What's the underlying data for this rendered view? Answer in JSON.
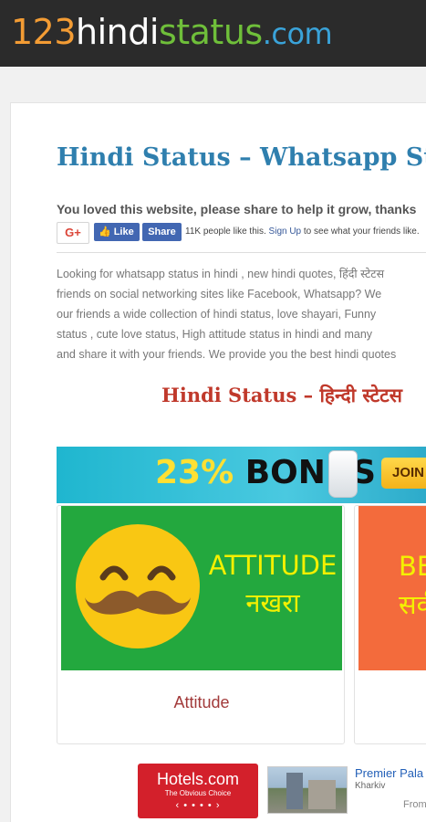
{
  "header": {
    "logo": {
      "num": "123",
      "hindi": "hindi",
      "status": "status",
      "com": ".com"
    }
  },
  "main": {
    "title": "Hindi Status – Whatsapp Status",
    "share_prompt": "You loved this website, please share to help it grow, thanks",
    "social": {
      "gplus_label": "G+",
      "like_label": "Like",
      "share_label": "Share",
      "count_text": "11K people like this.",
      "signup_text": "Sign Up",
      "count_suffix": " to see what your friends like."
    },
    "intro_lines": [
      "Looking for whatsapp status in hindi , new hindi quotes, हिंदी स्टेटस",
      "friends on social networking sites like Facebook, Whatsapp? We",
      "our friends a wide collection of hindi status, love shayari, Funny",
      "status , cute love status, High attitude status in hindi and many",
      "and share it with your friends. We provide you the best hindi quotes"
    ],
    "sub_heading": "Hindi Status – हिन्दी स्टेटस"
  },
  "ad_banner": {
    "percent": "23%",
    "bonus": " BONUS",
    "cta": "JOIN"
  },
  "categories": [
    {
      "image_text_en": "ATTITUDE",
      "image_text_hi": "नखरा",
      "label": "Attitude"
    },
    {
      "image_text_en": "BE",
      "image_text_hi": "सर्व",
      "label": ""
    }
  ],
  "bottom_ads": {
    "hotels_brand": "Hotels.com",
    "hotels_tagline": "The Obvious Choice",
    "hotels_arrows": "‹ • • • • ›",
    "hotel_name": "Premier Pala",
    "hotel_city": "Kharkiv",
    "hotel_from": "From"
  },
  "colors": {
    "header_bg": "#2b2b2b",
    "title": "#2f7fae",
    "sub_heading": "#c0392b",
    "facebook": "#4267b2",
    "tile_green": "#23a83e",
    "tile_orange": "#f36b3c"
  },
  "icons": {
    "like": "thumbs-up-icon",
    "gplus": "google-plus-icon",
    "smiley": "mustache-smiley-icon"
  }
}
